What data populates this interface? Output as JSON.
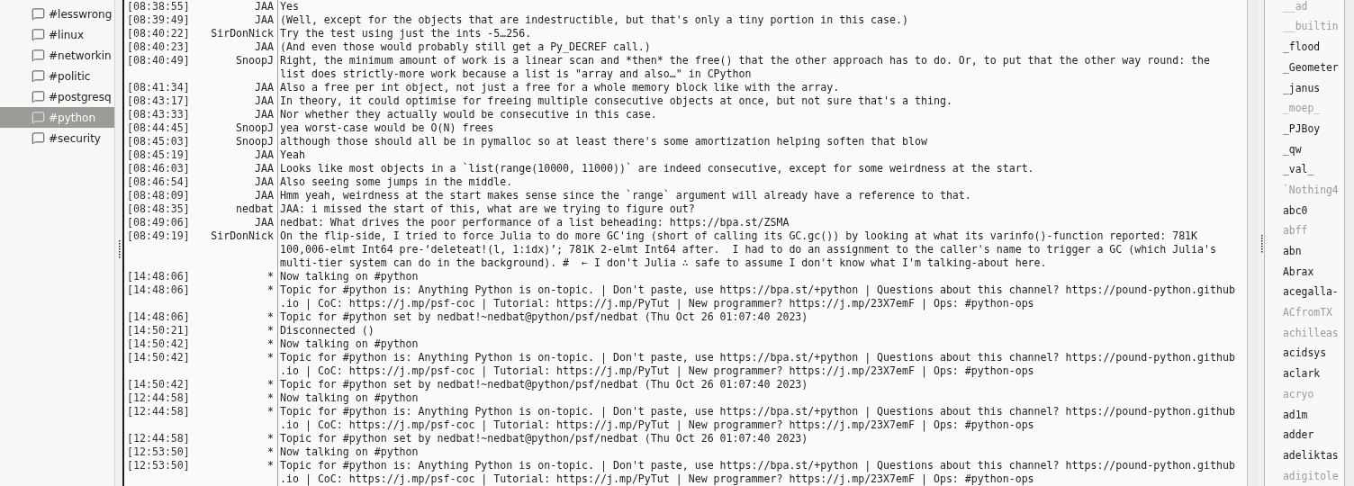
{
  "channels": [
    {
      "name": "#lesswrong",
      "selected": false
    },
    {
      "name": "#linux",
      "selected": false
    },
    {
      "name": "#networkin",
      "selected": false
    },
    {
      "name": "#politic",
      "selected": false
    },
    {
      "name": "#postgresq",
      "selected": false
    },
    {
      "name": "#python",
      "selected": true
    },
    {
      "name": "#security",
      "selected": false
    }
  ],
  "messages": [
    {
      "time": "[08:38:55]",
      "nick": "JAA",
      "lines": [
        "Yes"
      ]
    },
    {
      "time": "[08:39:49]",
      "nick": "JAA",
      "lines": [
        "(Well, except for the objects that are indestructible, but that's only a tiny portion in this case.)"
      ]
    },
    {
      "time": "[08:40:22]",
      "nick": "SirDonNick",
      "lines": [
        "Try the test using just the ints -5…256."
      ]
    },
    {
      "time": "[08:40:23]",
      "nick": "JAA",
      "lines": [
        "(And even those would probably still get a Py_DECREF call.)"
      ]
    },
    {
      "time": "[08:40:49]",
      "nick": "SnoopJ",
      "lines": [
        "Right, the minimum amount of work is a linear scan and *then* the free() that the other approach has to do. Or, to put that the other way round: the",
        "list does strictly-more work because a list is \"array and also…\" in CPython"
      ]
    },
    {
      "time": "[08:41:34]",
      "nick": "JAA",
      "lines": [
        "Also a free per int object, not just a free for a whole memory block like with the array."
      ]
    },
    {
      "time": "[08:43:17]",
      "nick": "JAA",
      "lines": [
        "In theory, it could optimise for freeing multiple consecutive objects at once, but not sure that's a thing."
      ]
    },
    {
      "time": "[08:43:33]",
      "nick": "JAA",
      "lines": [
        "Nor whether they actually would be consecutive in this case."
      ]
    },
    {
      "time": "[08:44:45]",
      "nick": "SnoopJ",
      "lines": [
        "yea worst-case would be O(N) frees"
      ]
    },
    {
      "time": "[08:45:03]",
      "nick": "SnoopJ",
      "lines": [
        "although those should all be in pymalloc so at least there's some amortization helping soften that blow"
      ]
    },
    {
      "time": "[08:45:19]",
      "nick": "JAA",
      "lines": [
        "Yeah"
      ]
    },
    {
      "time": "[08:46:03]",
      "nick": "JAA",
      "lines": [
        "Looks like most objects in a `list(range(10000, 11000))` are indeed consecutive, except for some weirdness at the start."
      ]
    },
    {
      "time": "[08:46:54]",
      "nick": "JAA",
      "lines": [
        "Also seeing some jumps in the middle."
      ]
    },
    {
      "time": "[08:48:09]",
      "nick": "JAA",
      "lines": [
        "Hmm yeah, weirdness at the start makes sense since the `range` argument will already have a reference to that."
      ]
    },
    {
      "time": "[08:48:35]",
      "nick": "nedbat",
      "lines": [
        "JAA: i missed the start of this, what are we trying to figure out?"
      ]
    },
    {
      "time": "[08:49:06]",
      "nick": "JAA",
      "lines": [
        "nedbat: What drives the poor performance of a list beheading: https://bpa.st/ZSMA"
      ]
    },
    {
      "time": "[08:49:19]",
      "nick": "SirDonNick",
      "lines": [
        "On the flip-side, I tried to force Julia to do more GC'ing (short of calling its GC.gc()) by looking at what its varinfo()-function reported: 781K",
        "100,006-elmt Int64 pre-‘deleteat!(l, 1:idx)’; 781K 2-elmt Int64 after.  I had to do an assignment to the caller's name to trigger a GC (which Julia's",
        "multi-tier system can do in the background). #  ← I don't Julia ∴ safe to assume I don't know what I'm talking-about here."
      ]
    },
    {
      "time": "[14:48:06]",
      "nick": "*",
      "lines": [
        "Now talking on #python"
      ]
    },
    {
      "time": "[14:48:06]",
      "nick": "*",
      "lines": [
        "Topic for #python is: Anything Python is on-topic. | Don't paste, use https://bpa.st/+python | Questions about this channel? https://pound-python.github",
        ".io | CoC: https://j.mp/psf-coc | Tutorial: https://j.mp/PyTut | New programmer? https://j.mp/23X7emF | Ops: #python-ops"
      ]
    },
    {
      "time": "[14:48:06]",
      "nick": "*",
      "lines": [
        "Topic for #python set by nedbat!~nedbat@python/psf/nedbat (Thu Oct 26 01:07:40 2023)"
      ]
    },
    {
      "time": "[14:50:21]",
      "nick": "*",
      "lines": [
        "Disconnected ()"
      ]
    },
    {
      "time": "[14:50:42]",
      "nick": "*",
      "lines": [
        "Now talking on #python"
      ]
    },
    {
      "time": "[14:50:42]",
      "nick": "*",
      "lines": [
        "Topic for #python is: Anything Python is on-topic. | Don't paste, use https://bpa.st/+python | Questions about this channel? https://pound-python.github",
        ".io | CoC: https://j.mp/psf-coc | Tutorial: https://j.mp/PyTut | New programmer? https://j.mp/23X7emF | Ops: #python-ops"
      ]
    },
    {
      "time": "[14:50:42]",
      "nick": "*",
      "lines": [
        "Topic for #python set by nedbat!~nedbat@python/psf/nedbat (Thu Oct 26 01:07:40 2023)"
      ]
    },
    {
      "time": "[12:44:58]",
      "nick": "*",
      "lines": [
        "Now talking on #python"
      ]
    },
    {
      "time": "[12:44:58]",
      "nick": "*",
      "lines": [
        "Topic for #python is: Anything Python is on-topic. | Don't paste, use https://bpa.st/+python | Questions about this channel? https://pound-python.github",
        ".io | CoC: https://j.mp/psf-coc | Tutorial: https://j.mp/PyTut | New programmer? https://j.mp/23X7emF | Ops: #python-ops"
      ]
    },
    {
      "time": "[12:44:58]",
      "nick": "*",
      "lines": [
        "Topic for #python set by nedbat!~nedbat@python/psf/nedbat (Thu Oct 26 01:07:40 2023)"
      ]
    },
    {
      "time": "[12:53:50]",
      "nick": "*",
      "lines": [
        "Now talking on #python"
      ]
    },
    {
      "time": "[12:53:50]",
      "nick": "*",
      "lines": [
        "Topic for #python is: Anything Python is on-topic. | Don't paste, use https://bpa.st/+python | Questions about this channel? https://pound-python.github",
        ".io | CoC: https://j.mp/psf-coc | Tutorial: https://j.mp/PyTut | New programmer? https://j.mp/23X7emF | Ops: #python-ops"
      ]
    }
  ],
  "users": [
    {
      "name": "__ad",
      "away": true
    },
    {
      "name": "__builtin",
      "away": true
    },
    {
      "name": "_flood",
      "away": false
    },
    {
      "name": "_Geometer",
      "away": false
    },
    {
      "name": "_janus",
      "away": false
    },
    {
      "name": "_moep_",
      "away": true
    },
    {
      "name": "_PJBoy",
      "away": false
    },
    {
      "name": "_qw",
      "away": false
    },
    {
      "name": "_val_",
      "away": false
    },
    {
      "name": "`Nothing4",
      "away": true
    },
    {
      "name": "abc0",
      "away": false
    },
    {
      "name": "abff",
      "away": true
    },
    {
      "name": "abn",
      "away": false
    },
    {
      "name": "Abrax",
      "away": false
    },
    {
      "name": "acegalla-",
      "away": false
    },
    {
      "name": "ACfromTX",
      "away": true
    },
    {
      "name": "achilleas",
      "away": true
    },
    {
      "name": "acidsys",
      "away": false
    },
    {
      "name": "aclark",
      "away": false
    },
    {
      "name": "acryo",
      "away": true
    },
    {
      "name": "ad1m",
      "away": false
    },
    {
      "name": "adder",
      "away": false
    },
    {
      "name": "adeliktas",
      "away": false
    },
    {
      "name": "adigitole",
      "away": true
    }
  ]
}
